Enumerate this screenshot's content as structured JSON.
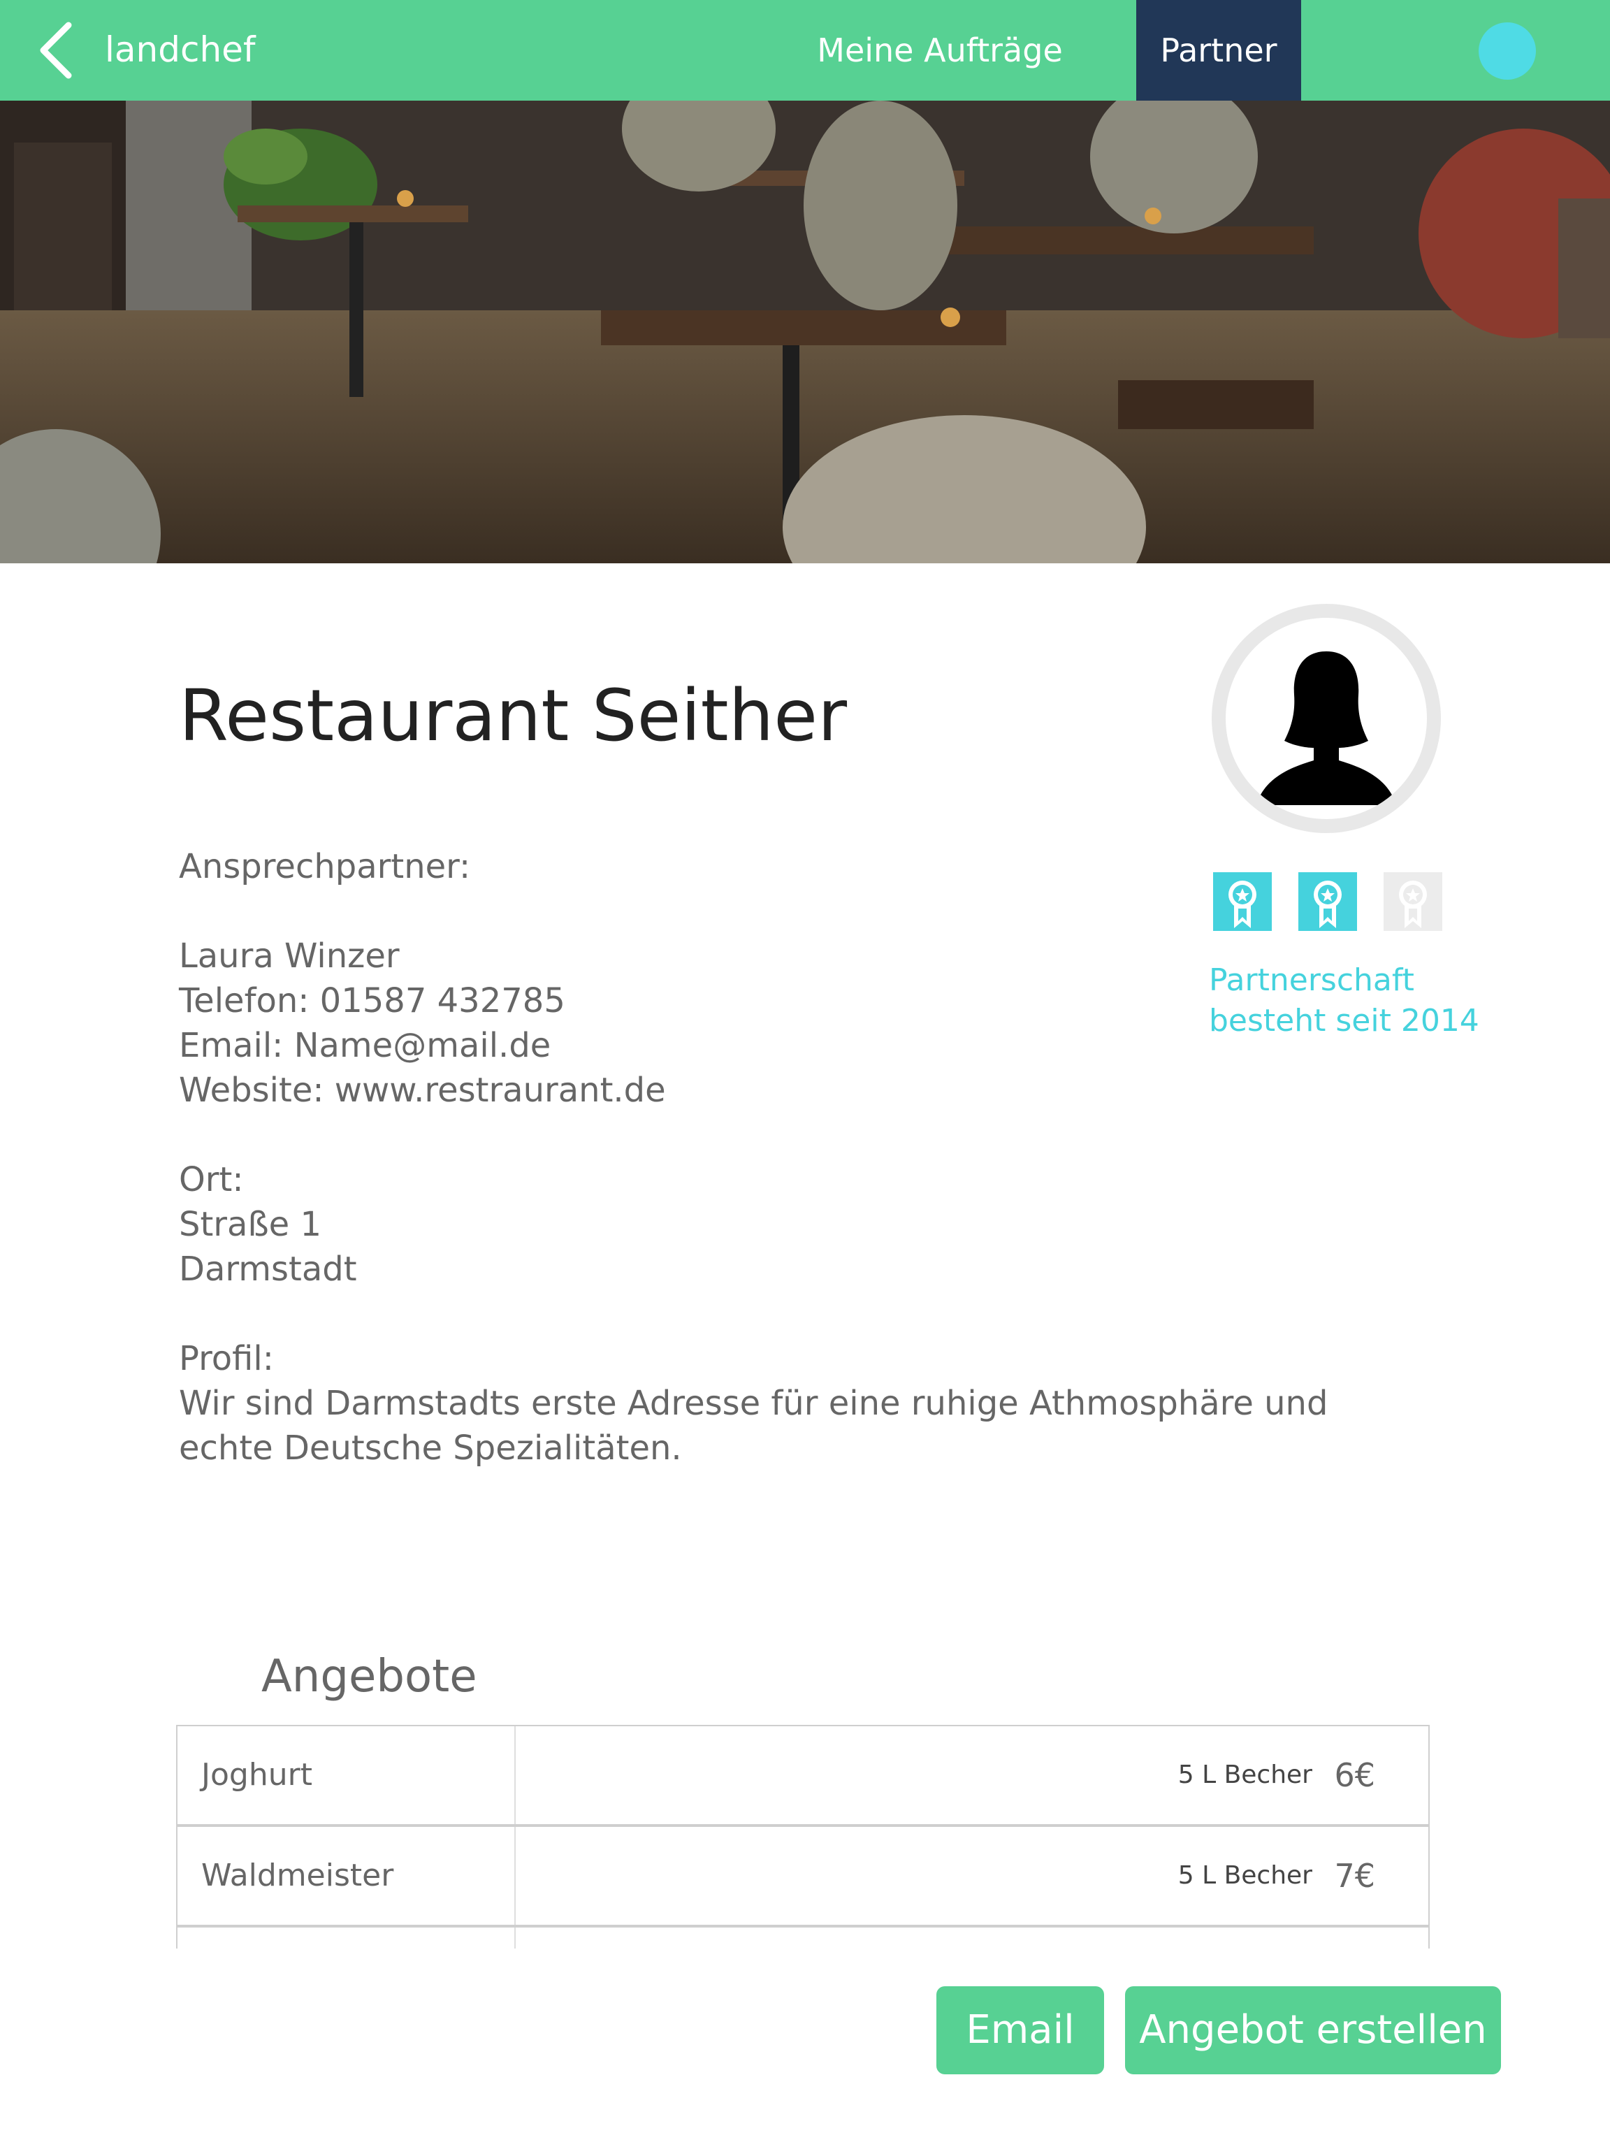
{
  "nav": {
    "brand": "landchef",
    "tabs": [
      {
        "label": "Meine Aufträge",
        "active": false
      },
      {
        "label": "Partner",
        "active": true
      }
    ],
    "colors": {
      "bar": "#57d193",
      "active_tab": "#213757",
      "user_dot": "#4fdbe5"
    }
  },
  "partner": {
    "name": "Restaurant Seither",
    "contact_heading": "Ansprechpartner:",
    "contact_name": "Laura Winzer",
    "phone": "Telefon: 01587 432785",
    "email": "Email: Name@mail.de",
    "website": "Website: www.restraurant.de",
    "location_heading": "Ort:",
    "street": "Straße 1",
    "city": "Darmstadt",
    "profile_heading": "Profil:",
    "profile_line1": "Wir sind Darmstadts erste Adresse für eine ruhige Athmosphäre und",
    "profile_line2": "echte Deutsche Spezialitäten.",
    "partnership_line1": "Partnerschaft",
    "partnership_line2": "besteht seit 2014",
    "badges": {
      "earned": 2,
      "total": 3
    }
  },
  "offers": {
    "title": "Angebote",
    "items": [
      {
        "name": "Joghurt",
        "unit": "5 L Becher",
        "price": "6€"
      },
      {
        "name": "Waldmeister",
        "unit": "5 L Becher",
        "price": "7€"
      }
    ]
  },
  "actions": {
    "email_label": "Email",
    "create_offer_label": "Angebot erstellen"
  },
  "icons": [
    "chevron-left-icon",
    "user-avatar-icon",
    "award-ribbon-icon"
  ]
}
